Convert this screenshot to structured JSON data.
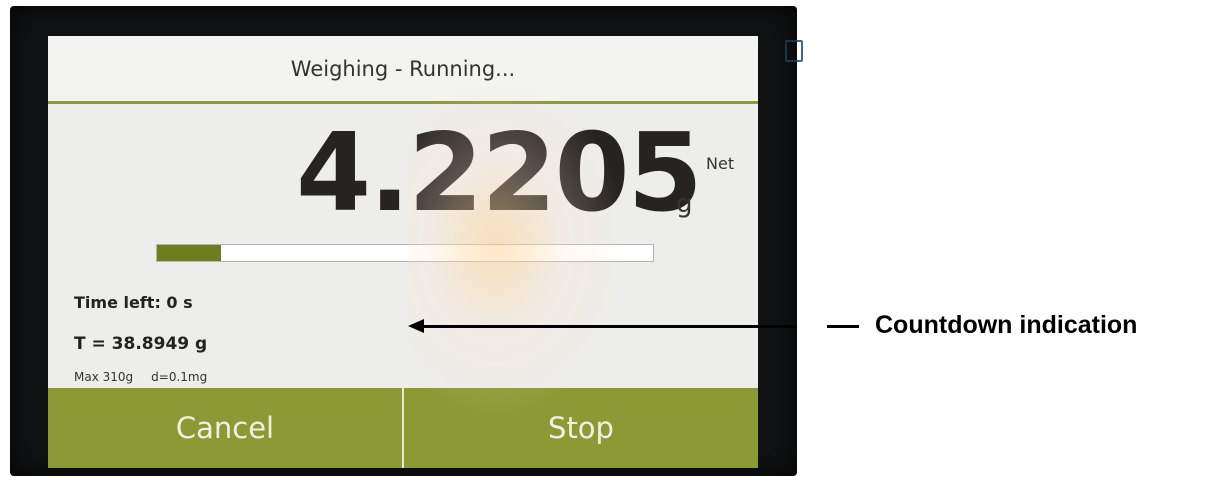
{
  "header": {
    "title": "Weighing - Running..."
  },
  "reading": {
    "value": "4.2205",
    "net_label": "Net",
    "unit": "g"
  },
  "progress": {
    "fraction": 0.13
  },
  "info": {
    "time_left": "Time left: 0 s",
    "tare": "T = 38.8949 g",
    "max_capacity": "Max 310g",
    "readability": "d=0.1mg"
  },
  "buttons": {
    "cancel_label": "Cancel",
    "stop_label": "Stop"
  },
  "annotation": {
    "label": "Countdown indication"
  },
  "colors": {
    "accent_green": "#8c9a35",
    "progress_fill": "#6e7d1e"
  }
}
